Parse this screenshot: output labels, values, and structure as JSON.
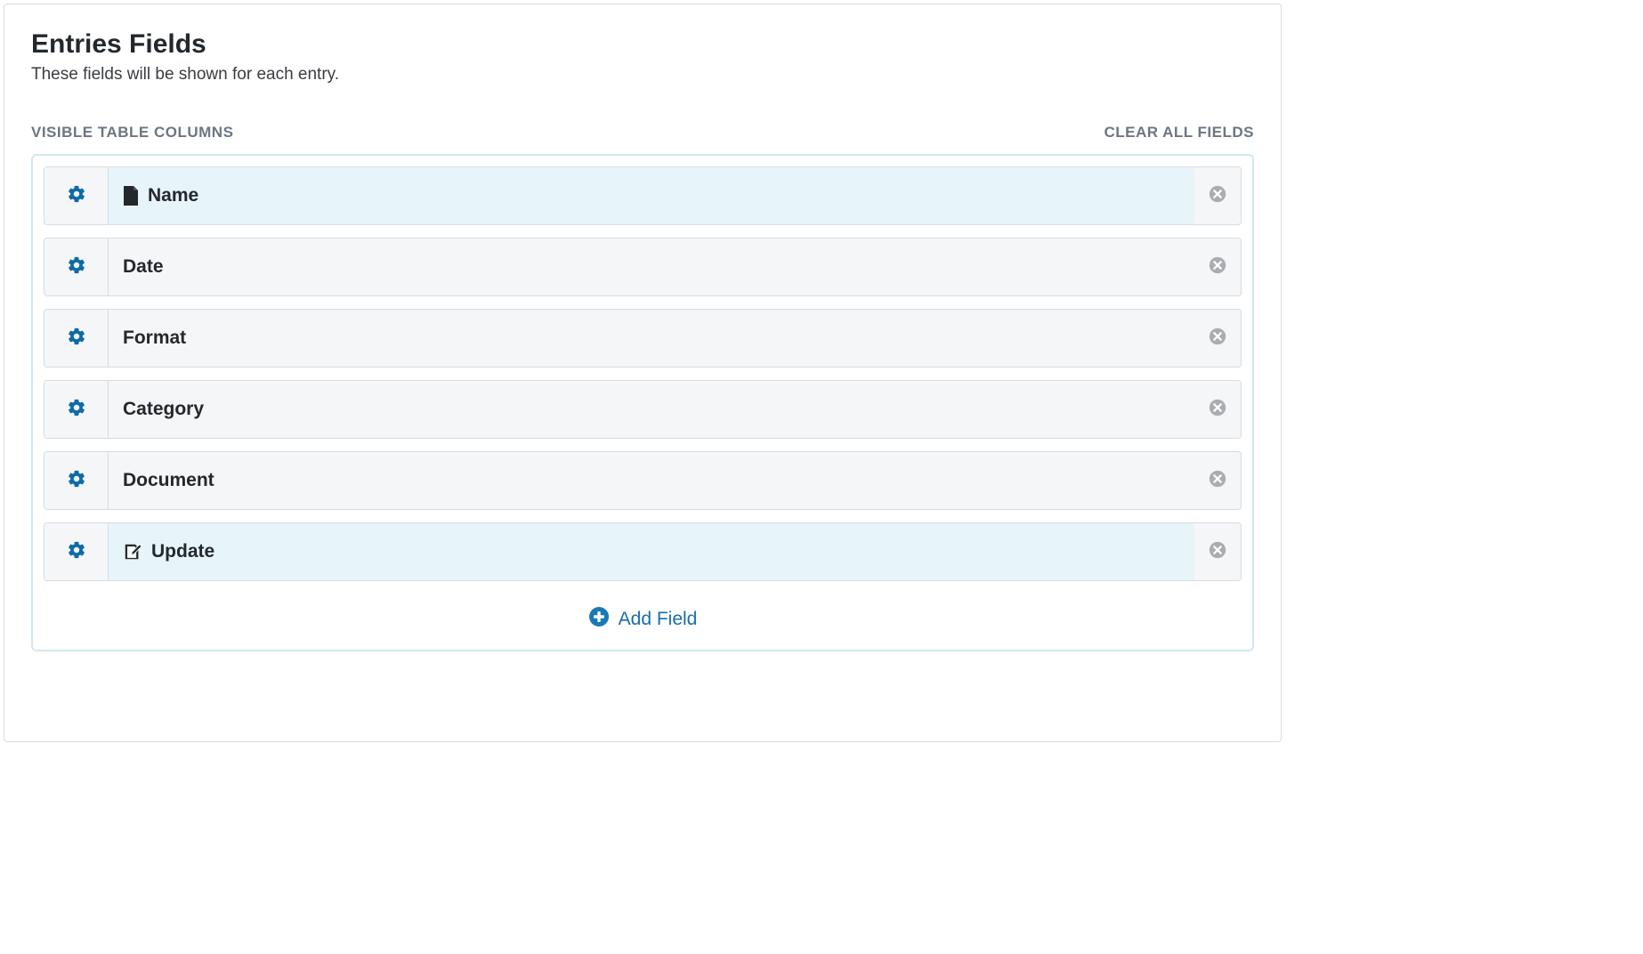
{
  "header": {
    "title": "Entries Fields",
    "subtitle": "These fields will be shown for each entry."
  },
  "toolbar": {
    "section_label": "VISIBLE TABLE COLUMNS",
    "clear_all": "CLEAR ALL FIELDS"
  },
  "fields": [
    {
      "label": "Name",
      "icon": "file-icon",
      "highlighted": true
    },
    {
      "label": "Date",
      "icon": null,
      "highlighted": false
    },
    {
      "label": "Format",
      "icon": null,
      "highlighted": false
    },
    {
      "label": "Category",
      "icon": null,
      "highlighted": false
    },
    {
      "label": "Document",
      "icon": null,
      "highlighted": false
    },
    {
      "label": "Update",
      "icon": "edit-icon",
      "highlighted": true
    }
  ],
  "footer": {
    "add_field": "Add Field"
  },
  "colors": {
    "accent": "#0e6ba8",
    "muted": "#a8adb2"
  }
}
